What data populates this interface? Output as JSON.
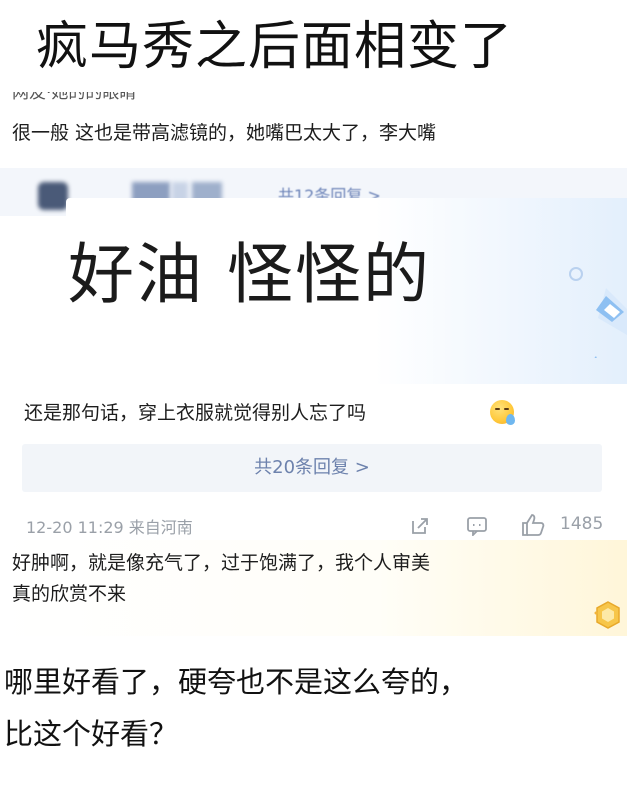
{
  "headline": "疯马秀之后面相变了",
  "cut_meta": "网友·她的的眼睛",
  "comments": [
    {
      "text": "很一般 这也是带高滤镜的，她嘴巴太大了，李大嘴"
    },
    {
      "text": "还是那句话，穿上衣服就觉得别人忘了吗"
    },
    {
      "lines": [
        "好肿啊，就是像充气了，过于饱满了，我个人审美",
        "真的欣赏不来"
      ]
    },
    {
      "lines": [
        "哪里好看了，硬夸也不是这么夸的，",
        "比这个好看？"
      ]
    }
  ],
  "blurred_reply": "共12条回复 >",
  "overlay_caption": "好油 怪怪的",
  "reply_bar": "共20条回复 >",
  "meta": {
    "date": "12-20 11:29",
    "location": "来自河南",
    "like_count": "1485"
  },
  "colors": {
    "link": "#6d82ad",
    "meta_gray": "#9aa0a8",
    "reply_bar_bg": "#f2f5f9"
  },
  "icons": [
    "share-icon",
    "comment-icon",
    "like-icon",
    "crying-emoji-icon",
    "fan-badge-icon",
    "diamond-decoration-icon"
  ]
}
